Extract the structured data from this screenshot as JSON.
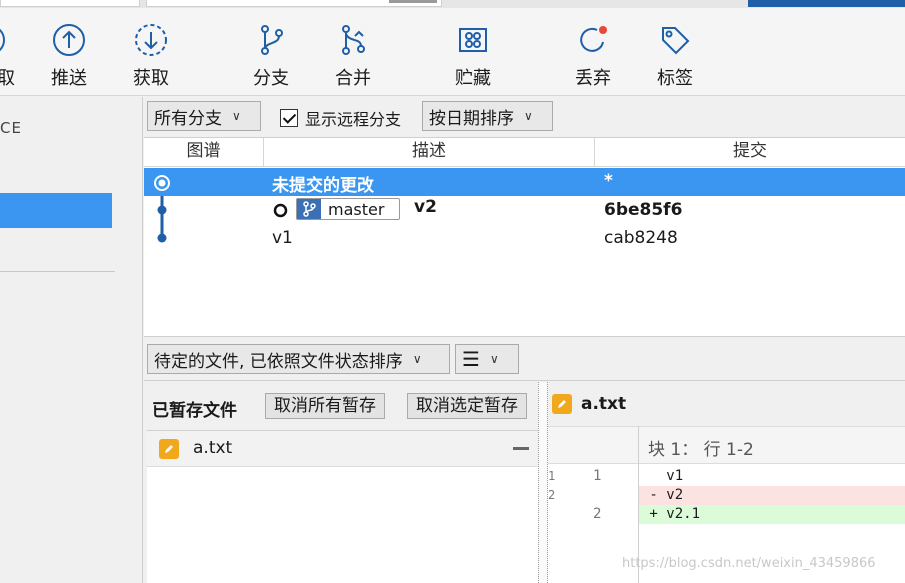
{
  "toolbar": {
    "items": [
      {
        "label": "取"
      },
      {
        "label": "推送"
      },
      {
        "label": "获取"
      },
      {
        "label": "分支"
      },
      {
        "label": "合并"
      },
      {
        "label": "贮藏"
      },
      {
        "label": "丢弃"
      },
      {
        "label": "标签"
      }
    ]
  },
  "sidebar": {
    "workspace_fragment": "CE"
  },
  "filters": {
    "branch_select": "所有分支",
    "show_remote_label": "显示远程分支",
    "show_remote_checked": true,
    "sort_select": "按日期排序"
  },
  "commits": {
    "columns": [
      "图谱",
      "描述",
      "提交"
    ],
    "rows": [
      {
        "description": "未提交的更改",
        "hash": "*"
      },
      {
        "branch": "master",
        "description": "v2",
        "hash": "6be85f6"
      },
      {
        "description": "v1",
        "hash": "cab8248"
      }
    ]
  },
  "lower": {
    "sort_select": "待定的文件, 已依照文件状态排序",
    "view_icon": "list-icon"
  },
  "staged": {
    "title": "已暂存文件",
    "unstage_all": "取消所有暂存",
    "unstage_selected": "取消选定暂存",
    "files": [
      {
        "name": "a.txt"
      }
    ]
  },
  "diff": {
    "filename": "a.txt",
    "hunk_header": "块 1： 行 1-2",
    "lines": [
      {
        "old": "1",
        "new": "1",
        "text": "   v1"
      },
      {
        "old": "2",
        "new": "",
        "text": " - v2"
      },
      {
        "old": "",
        "new": "2",
        "text": " + v2.1"
      }
    ],
    "watermark": "https://blog.csdn.net/weixin_43459866"
  },
  "colors": {
    "accent": "#3a96f0",
    "icon_blue": "#1e5fa8",
    "discard_dot": "#e8483a",
    "modified": "#f2a81d"
  }
}
